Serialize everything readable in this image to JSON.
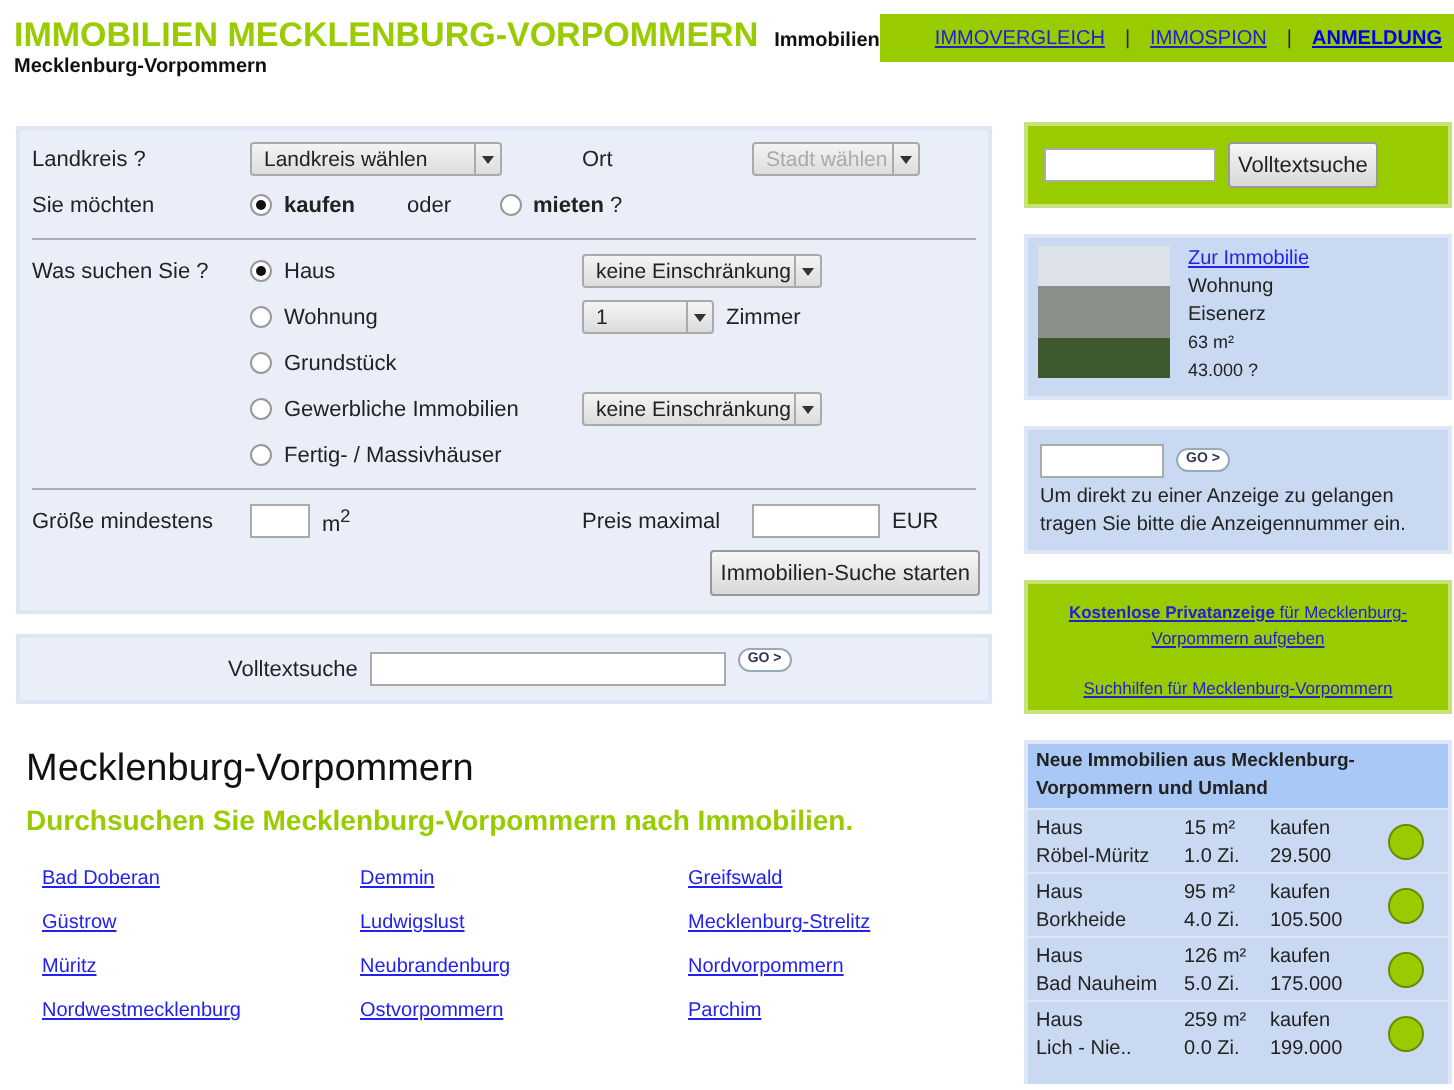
{
  "header": {
    "title": "IMMOBILIEN MECKLENBURG-VORPOMMERN",
    "tagline_line1": "Immobilien",
    "tagline_line2": "Mecklenburg-Vorpommern",
    "nav": [
      "IMMOVERGLEICH",
      "IMMOSPION",
      "ANMELDUNG"
    ],
    "nav_separator": "|"
  },
  "search_form": {
    "landkreis_label": "Landkreis ?",
    "landkreis_select": "Landkreis wählen",
    "ort_label": "Ort",
    "ort_select": {
      "value": "Stadt wählen",
      "disabled": true
    },
    "intent_label": "Sie möchten",
    "intent_options": [
      {
        "label": "kaufen",
        "selected": true
      },
      {
        "label": "mieten",
        "suffix": "?",
        "selected": false
      }
    ],
    "intent_joiner": "oder",
    "type_label": "Was suchen Sie ?",
    "types": [
      {
        "label": "Haus",
        "selected": true,
        "select": "keine Einschränkung"
      },
      {
        "label": "Wohnung",
        "selected": false,
        "select": "1",
        "unit": "Zimmer"
      },
      {
        "label": "Grundstück",
        "selected": false
      },
      {
        "label": "Gewerbliche Immobilien",
        "selected": false,
        "select": "keine Einschränkung"
      },
      {
        "label": "Fertig- / Massivhäuser",
        "selected": false
      }
    ],
    "size_label": "Größe mindestens",
    "size_unit": "m$^{2}$",
    "price_label": "Preis maximal",
    "price_unit": "EUR",
    "submit": "Immobilien-Suche starten"
  },
  "fulltext_bar": {
    "label": "Volltextsuche",
    "go": "GO >"
  },
  "intro": {
    "heading": "Mecklenburg-Vorpommern",
    "subheading": "Durchsuchen Sie Mecklenburg-Vorpommern nach Immobilien.",
    "regions": [
      "Bad Doberan",
      "Demmin",
      "Greifswald",
      "Güstrow",
      "Ludwigslust",
      "Mecklenburg-Strelitz",
      "Müritz",
      "Neubrandenburg",
      "Nordvorpommern",
      "Nordwestmecklenburg",
      "Ostvorpommern",
      "Parchim"
    ]
  },
  "sidebar": {
    "fulltext_button": "Volltextsuche",
    "featured": {
      "link": "Zur Immobilie",
      "lines": [
        "Wohnung",
        "Eisenerz",
        "63 m²",
        "43.000 ?"
      ]
    },
    "ad_lookup": {
      "go": "GO >",
      "text": "Um direkt zu einer Anzeige zu gelangen tragen Sie bitte die Anzeigennummer ein."
    },
    "promo": {
      "links": [
        "**Kostenlose Privatanzeige** für Mecklenburg-Vorpommern aufgeben",
        "Suchhilfen für Mecklenburg-Vorpommern"
      ]
    },
    "new_listings": {
      "title": "Neue Immobilien aus Mecklenburg-Vorpommern und Umland",
      "rows": [
        {
          "type": "Haus",
          "size": "15 m²",
          "deal": "kaufen",
          "place": "Röbel-Müritz",
          "rooms": "1.0 Zi.",
          "price": "29.500"
        },
        {
          "type": "Haus",
          "size": "95 m²",
          "deal": "kaufen",
          "place": "Borkheide",
          "rooms": "4.0 Zi.",
          "price": "105.500"
        },
        {
          "type": "Haus",
          "size": "126 m²",
          "deal": "kaufen",
          "place": "Bad Nauheim",
          "rooms": "5.0 Zi.",
          "price": "175.000"
        },
        {
          "type": "Haus",
          "size": "259 m²",
          "deal": "kaufen",
          "place": "Lich - Nie..",
          "rooms": "0.0 Zi.",
          "price": "199.000"
        }
      ]
    }
  }
}
